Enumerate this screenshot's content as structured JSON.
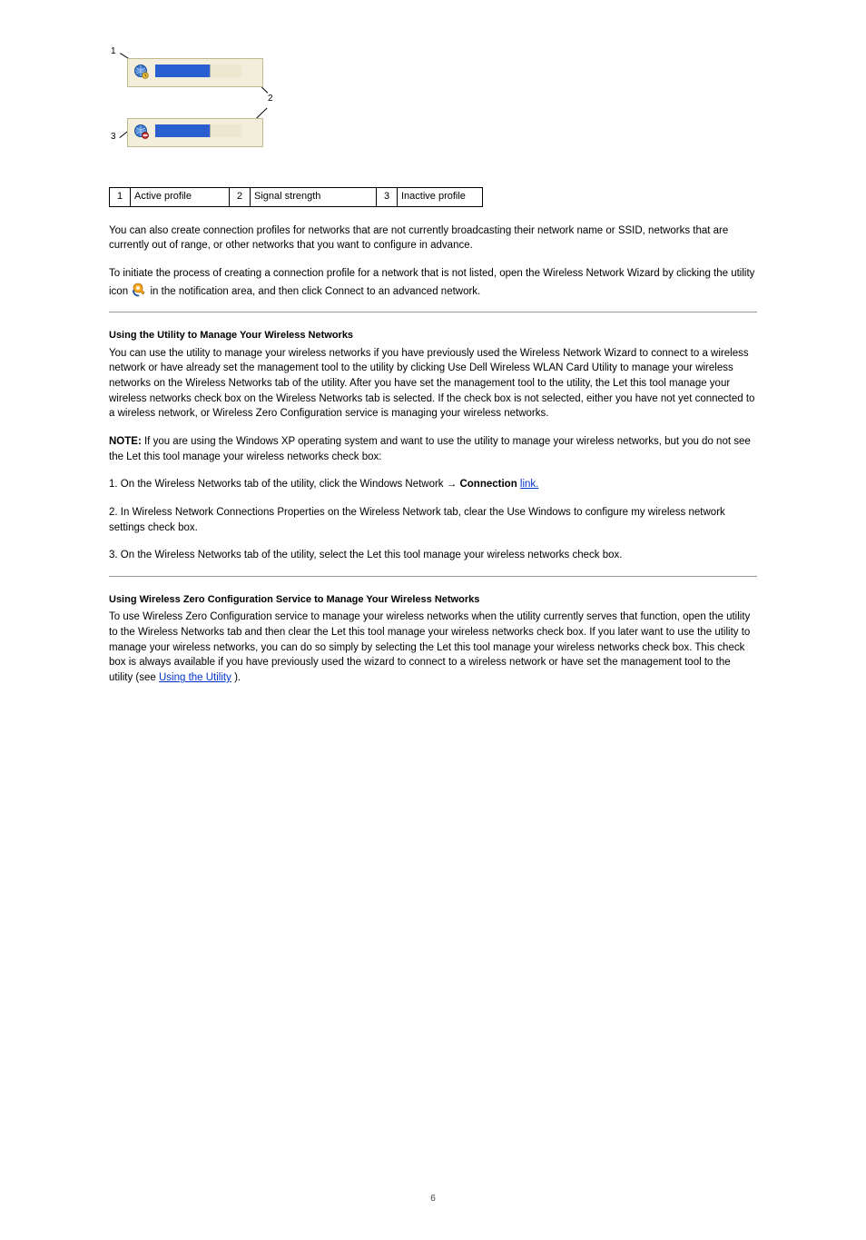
{
  "figure": {
    "labels": {
      "l1": "1",
      "l2": "2",
      "l3": "3"
    }
  },
  "key": {
    "c1n": "1",
    "c1t": "Active profile",
    "c2n": "2",
    "c2t": "Signal strength",
    "c3n": "3",
    "c3t": "Inactive profile"
  },
  "para_existing": "You can also create connection profiles for networks that are not currently broadcasting their network name or SSID, networks that are currently out of range, or other networks that you want to configure in advance.",
  "para_create": "To initiate the process of creating a connection profile for a network that is not listed, open the Wireless Network Wizard by clicking the utility icon ",
  "para_create_tail": " in the notification area, and then click Connect to an advanced network.",
  "using_utility": {
    "title": "Using the Utility to Manage Your Wireless Networks",
    "para1_1": "You can use the utility to manage your wireless networks if you have previously used the Wireless Network Wizard to connect to a wireless network or have already set the management tool to the utility by clicking Use Dell Wireless WLAN Card Utility to manage your wireless networks on the Wireless Networks tab of the utility. After you have set the management tool to the utility, the Let this tool manage your wireless networks check box on the Wireless Networks tab is selected. If the check box is not selected, either you have not yet connected to a wireless network, or Wireless Zero Configuration service is managing your wireless networks.",
    "note_label": "NOTE:",
    "note_body": " If you are using the Windows XP operating system and want to use the utility to manage your wireless networks, but you do not see the Let this tool manage your wireless networks check box:",
    "step1_a": "On the Wireless Networks tab of the utility, click the Windows Network ",
    "step1_b": "Connection",
    "step1_c": " link.",
    "step2": "In Wireless Network Connections Properties on the Wireless Network tab, clear the Use Windows to configure my wireless network settings check box.",
    "step3": "On the Wireless Networks tab of the utility, select the Let this tool manage your wireless networks check box."
  },
  "wzc": {
    "title": "Using Wireless Zero Configuration Service to Manage Your Wireless Networks",
    "body_a": "To use Wireless Zero Configuration service to manage your wireless networks when the utility currently serves that function, open the utility to the Wireless Networks tab and then clear the Let this tool manage your wireless networks check box. If you later want to use the utility to manage your wireless networks, you can do so simply by selecting the Let this tool manage your wireless networks check box. This check box is always available if you have previously used the wizard to connect to a wireless network or have set the management tool to the utility (see ",
    "link": "Using the Utility",
    "body_b": ")."
  },
  "pagenum": "6"
}
